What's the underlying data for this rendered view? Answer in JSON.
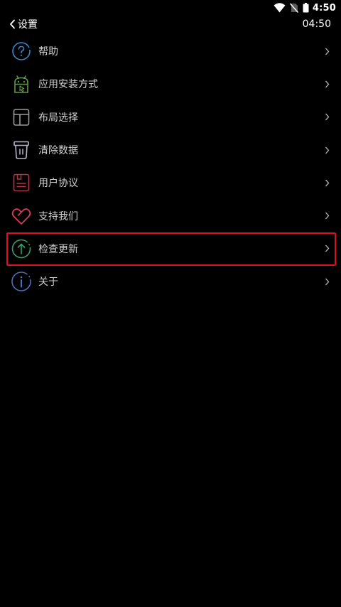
{
  "status_bar": {
    "time": "4:50",
    "icons": [
      "wifi-icon",
      "no-sim-icon",
      "battery-icon"
    ]
  },
  "header": {
    "back_icon": "chevron-left-icon",
    "title": "设置",
    "clock": "04:50"
  },
  "menu": {
    "items": [
      {
        "label": "帮助",
        "icon": "help-circle-icon",
        "color": "#3b86c4"
      },
      {
        "label": "应用安装方式",
        "icon": "android-icon",
        "color": "#5e9a48"
      },
      {
        "label": "布局选择",
        "icon": "layout-icon",
        "color": "#9a9a9a"
      },
      {
        "label": "清除数据",
        "icon": "trash-icon",
        "color": "#b6b6c6"
      },
      {
        "label": "用户协议",
        "icon": "document-icon",
        "color": "#b23441"
      },
      {
        "label": "支持我们",
        "icon": "heart-icon",
        "color": "#d93a5f"
      },
      {
        "label": "检查更新",
        "icon": "upload-arrow-icon",
        "color": "#3a9e6a"
      },
      {
        "label": "关于",
        "icon": "info-circle-icon",
        "color": "#4b6fb8"
      }
    ],
    "selected_index": 6,
    "highlight_color": "#e0101a"
  }
}
